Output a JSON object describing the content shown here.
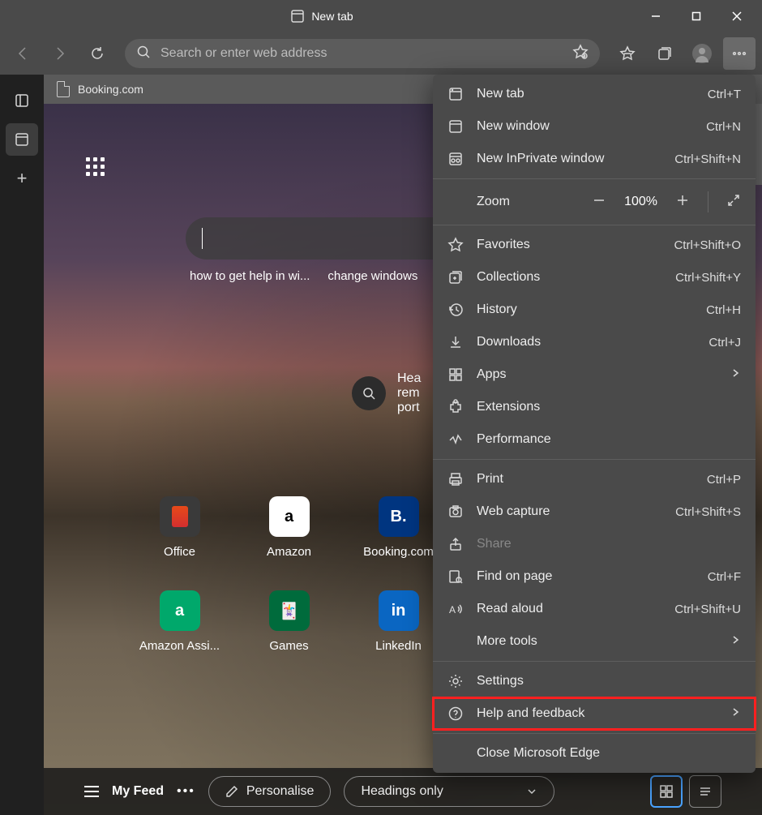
{
  "titlebar": {
    "title": "New tab"
  },
  "toolbar": {
    "search_placeholder": "Search or enter web address"
  },
  "tabstrip": {
    "tab_label": "Booking.com"
  },
  "content": {
    "trending": [
      "how to get help in wi...",
      "change windows"
    ],
    "headlines_text": "Hea\nrem\nport",
    "quicklinks": [
      {
        "label": "Office",
        "glyph": "O",
        "cls": "office"
      },
      {
        "label": "Amazon",
        "glyph": "a",
        "cls": "amazon"
      },
      {
        "label": "Booking.com",
        "glyph": "B.",
        "cls": "booking"
      },
      {
        "label": "",
        "glyph": "",
        "cls": ""
      },
      {
        "label": "Amazon Assi...",
        "glyph": "a",
        "cls": "wave"
      },
      {
        "label": "Games",
        "glyph": "🂡",
        "cls": "games"
      },
      {
        "label": "LinkedIn",
        "glyph": "in",
        "cls": "linkedin"
      },
      {
        "label": "",
        "glyph": "",
        "cls": ""
      }
    ]
  },
  "feedbar": {
    "label": "My Feed",
    "personalise": "Personalise",
    "headings_only": "Headings only"
  },
  "menu": {
    "zoom_label": "Zoom",
    "zoom_value": "100%",
    "items": [
      {
        "icon": "newtab",
        "label": "New tab",
        "shortcut": "Ctrl+T"
      },
      {
        "icon": "newwin",
        "label": "New window",
        "shortcut": "Ctrl+N"
      },
      {
        "icon": "inprivate",
        "label": "New InPrivate window",
        "shortcut": "Ctrl+Shift+N"
      }
    ],
    "items2": [
      {
        "icon": "star",
        "label": "Favorites",
        "shortcut": "Ctrl+Shift+O"
      },
      {
        "icon": "collections",
        "label": "Collections",
        "shortcut": "Ctrl+Shift+Y"
      },
      {
        "icon": "history",
        "label": "History",
        "shortcut": "Ctrl+H"
      },
      {
        "icon": "download",
        "label": "Downloads",
        "shortcut": "Ctrl+J"
      },
      {
        "icon": "apps",
        "label": "Apps",
        "shortcut": "",
        "submenu": true
      },
      {
        "icon": "ext",
        "label": "Extensions",
        "shortcut": ""
      },
      {
        "icon": "perf",
        "label": "Performance",
        "shortcut": ""
      }
    ],
    "items3": [
      {
        "icon": "print",
        "label": "Print",
        "shortcut": "Ctrl+P"
      },
      {
        "icon": "capture",
        "label": "Web capture",
        "shortcut": "Ctrl+Shift+S"
      },
      {
        "icon": "share",
        "label": "Share",
        "shortcut": "",
        "disabled": true
      },
      {
        "icon": "find",
        "label": "Find on page",
        "shortcut": "Ctrl+F"
      },
      {
        "icon": "read",
        "label": "Read aloud",
        "shortcut": "Ctrl+Shift+U"
      },
      {
        "icon": "",
        "label": "More tools",
        "shortcut": "",
        "submenu": true
      }
    ],
    "items4": [
      {
        "icon": "settings",
        "label": "Settings",
        "shortcut": ""
      },
      {
        "icon": "help",
        "label": "Help and feedback",
        "shortcut": "",
        "submenu": true,
        "highlighted": true
      }
    ],
    "items5": [
      {
        "icon": "",
        "label": "Close Microsoft Edge",
        "shortcut": ""
      }
    ]
  }
}
